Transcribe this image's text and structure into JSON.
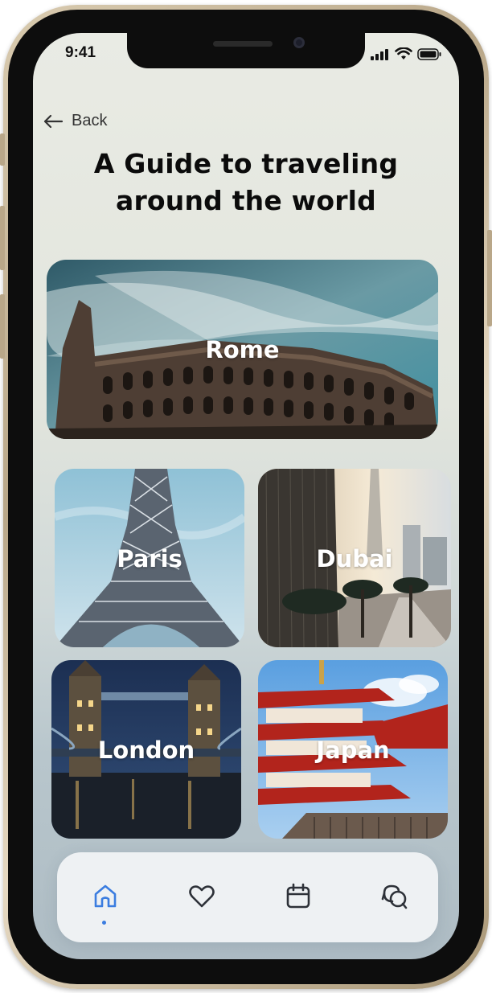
{
  "status_bar": {
    "time": "9:41"
  },
  "header": {
    "back_label": "Back",
    "title_line1": "A Guide to traveling",
    "title_line2": "around the world"
  },
  "destinations": [
    {
      "name": "Rome"
    },
    {
      "name": "Paris"
    },
    {
      "name": "Dubai"
    },
    {
      "name": "London"
    },
    {
      "name": "Japan"
    }
  ],
  "nav": {
    "items": [
      {
        "icon": "home-icon",
        "active": true
      },
      {
        "icon": "heart-icon",
        "active": false
      },
      {
        "icon": "calendar-icon",
        "active": false
      },
      {
        "icon": "chat-icon",
        "active": false
      }
    ],
    "active_color": "#3b7de0",
    "inactive_color": "#2d3138"
  }
}
